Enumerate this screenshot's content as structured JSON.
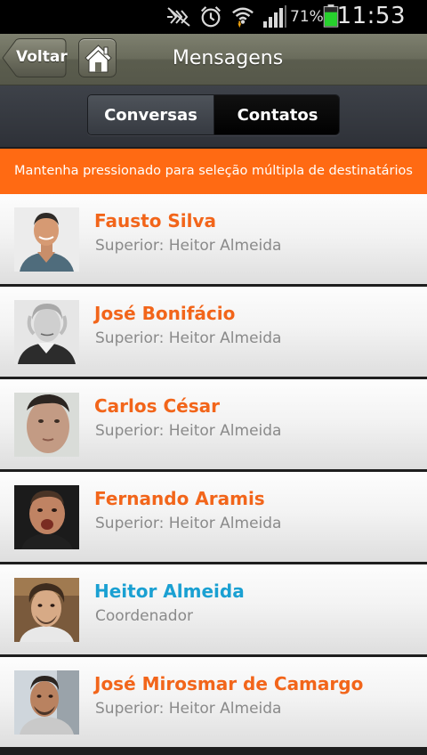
{
  "status_bar": {
    "time": "11:53",
    "battery_percent": "71%",
    "battery_level": 0.71,
    "icons": [
      "mute-icon",
      "alarm-icon",
      "wifi-icon",
      "signal-icon",
      "battery-icon"
    ]
  },
  "header": {
    "back_label": "Voltar",
    "title": "Mensagens"
  },
  "tabs": [
    {
      "label": "Conversas",
      "active": false
    },
    {
      "label": "Contatos",
      "active": true
    }
  ],
  "hint": "Mantenha pressionado para seleção múltipla de destinatários",
  "contacts": [
    {
      "name": "Fausto Silva",
      "role": "Superior: Heitor Almeida",
      "highlight": false
    },
    {
      "name": "José Bonifácio",
      "role": "Superior: Heitor Almeida",
      "highlight": false
    },
    {
      "name": "Carlos César",
      "role": "Superior: Heitor Almeida",
      "highlight": false
    },
    {
      "name": "Fernando Aramis",
      "role": "Superior: Heitor Almeida",
      "highlight": false
    },
    {
      "name": "Heitor Almeida",
      "role": "Coordenador",
      "highlight": true
    },
    {
      "name": "José Mirosmar de Camargo",
      "role": "Superior: Heitor Almeida",
      "highlight": false
    }
  ],
  "colors": {
    "accent_orange": "#ff6a13",
    "name_orange": "#f2651a",
    "name_blue": "#1aa0d2",
    "battery_green": "#27d12d"
  }
}
